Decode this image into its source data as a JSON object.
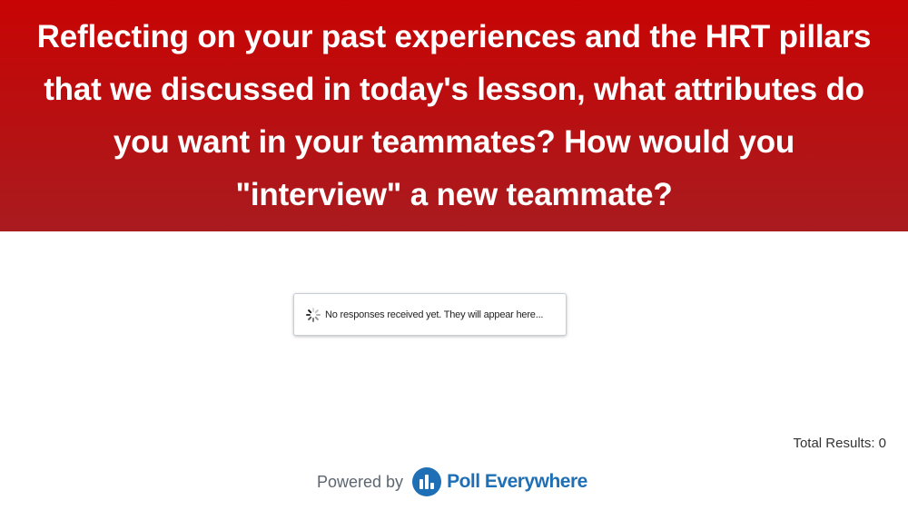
{
  "question": {
    "line1": "Reflecting on your past experiences and the HRT pillars",
    "line2": "that we discussed in today's lesson, what attributes do",
    "line3": "you want in your teammates? How would you",
    "line4": "\"interview\" a new teammate?"
  },
  "responses": {
    "empty_message": "No responses received yet. They will appear here..."
  },
  "results": {
    "total_label": "Total Results: 0"
  },
  "footer": {
    "powered_by": "Powered by",
    "brand": "Poll Everywhere",
    "logo_icon": "poll-everywhere-logo-icon"
  },
  "colors": {
    "header_top": "#c80404",
    "header_bottom": "#a91b1f",
    "brand_blue": "#1e6fb5"
  }
}
